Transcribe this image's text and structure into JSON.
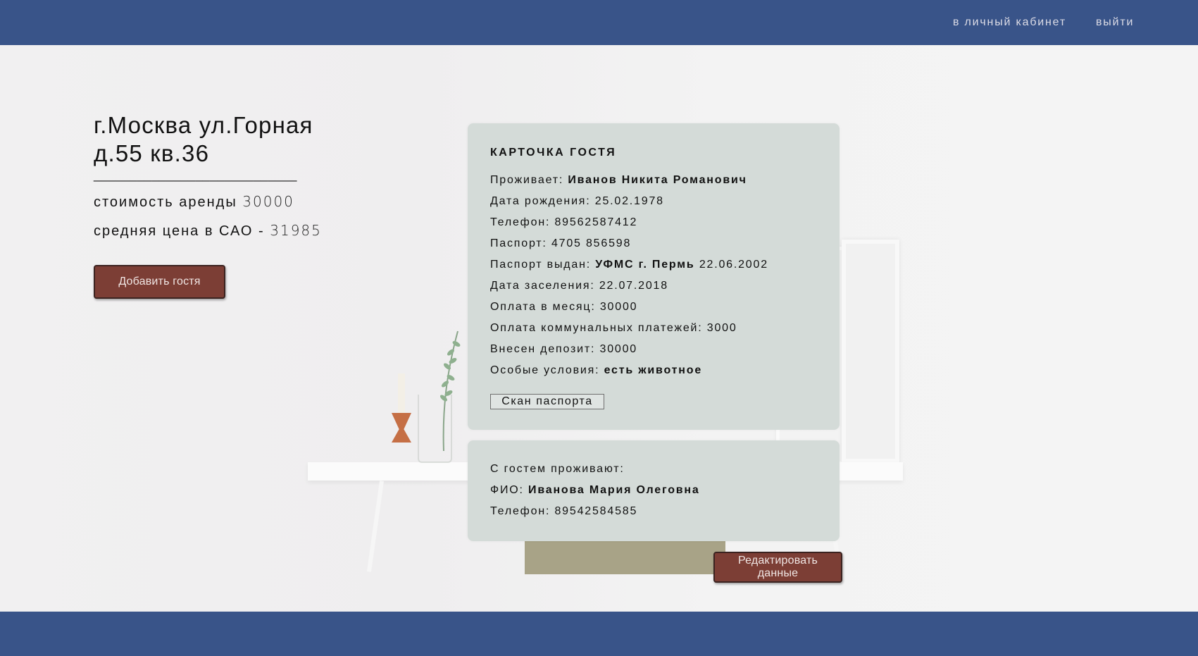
{
  "nav": {
    "cabinet_label": "в личный кабинет",
    "logout_label": "выйти"
  },
  "property": {
    "address_line1": "г.Москва ул.Горная",
    "address_line2": "д.55 кв.36",
    "separator": "____________________________",
    "rent_label": "стоимость аренды",
    "rent_value": "30000",
    "avg_label": "средняя цена в САО -",
    "avg_value": "31985",
    "add_guest_label": "Добавить гостя"
  },
  "guest_card": {
    "title": "КАРТОЧКА ГОСТЯ",
    "rows": [
      {
        "label": "Проживает:",
        "value": "Иванов Никита Романович"
      },
      {
        "label": "Дата рождения:",
        "value": "25.02.1978"
      },
      {
        "label": "Телефон:",
        "value": "89562587412"
      },
      {
        "label": "Паспорт:",
        "value": "4705 856598"
      },
      {
        "label": "Паспорт выдан:",
        "value": "УФМС г. Пермь",
        "extra": "22.06.2002"
      },
      {
        "label": "Дата заселения:",
        "value": "22.07.2018"
      },
      {
        "label": "Оплата в месяц:",
        "value": "30000"
      },
      {
        "label": "Оплата коммунальных платежей:",
        "value": "3000"
      },
      {
        "label": "Внесен депозит:",
        "value": "30000"
      },
      {
        "label": "Особые условия:",
        "value": "есть животное"
      }
    ],
    "scan_label": "Скан паспорта"
  },
  "cohabitant_card": {
    "heading": "С гостем проживают:",
    "name_label": "ФИО:",
    "name_value": "Иванова Мария Олеговна",
    "phone_label": "Телефон:",
    "phone_value": "89542584585"
  },
  "edit_label": "Редактировать данные",
  "colors": {
    "header": "#395489",
    "card": "#d4dbd8",
    "button": "#7c3e35"
  }
}
